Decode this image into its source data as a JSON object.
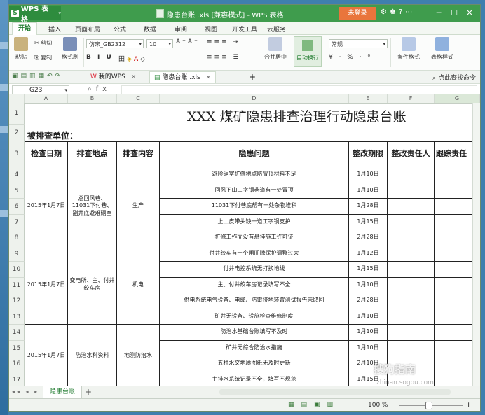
{
  "titlebar": {
    "app_name": "WPS 表格",
    "doc_title": "隐患台账 .xls [兼容模式] - WPS 表格",
    "login_label": "未登录",
    "icons": [
      "settings-icon",
      "shirt-icon",
      "help-icon",
      "more-icon"
    ]
  },
  "menu_tabs": [
    "开始",
    "插入",
    "页面布局",
    "公式",
    "数据",
    "审阅",
    "视图",
    "开发工具",
    "云服务"
  ],
  "ribbon": {
    "paste": "粘贴",
    "cut": "剪切",
    "copy": "复制",
    "format_painter": "格式刷",
    "font_name": "仿宋_GB2312",
    "font_size": "10",
    "merge": "合并居中",
    "wrap": "自动换行",
    "number_format": "常规",
    "percent_row": "¥ · % · ⁰",
    "cond_format": "条件格式",
    "table_style": "表格样式",
    "font_buttons": "B I U",
    "colors": {
      "accent": "#3f9c4d",
      "login": "#e9753c"
    }
  },
  "doc_tabs": [
    {
      "label": "我的WPS",
      "close": "×"
    },
    {
      "label": "隐患台账 .xls",
      "close": "×"
    }
  ],
  "quick_right": "点此查找命令",
  "formula_bar": {
    "name_box": "G23",
    "fx": "fx"
  },
  "columns": [
    "A",
    "B",
    "C",
    "D",
    "E",
    "F",
    "G"
  ],
  "rows": [
    "1",
    "2",
    "3",
    "4",
    "5",
    "6",
    "7",
    "8",
    "9",
    "10",
    "11",
    "12",
    "13",
    "14",
    "15",
    "16",
    "17"
  ],
  "sheet": {
    "title_prefix": "XXX",
    "title": "煤矿隐患排查治理行动隐患台账",
    "inspect_unit": "被排查单位：",
    "headers": [
      "检查日期",
      "排查地点",
      "排查内容",
      "隐患问题",
      "整改期限",
      "整改责任人",
      "跟踪责任"
    ],
    "groups": [
      {
        "date": "2015年1月7日",
        "location": "总回风巷、11031下付巷、副井底避难硐室",
        "content": "生产"
      },
      {
        "date": "2015年1月7日",
        "location": "变电所、主、付井绞车房",
        "content": "机电"
      },
      {
        "date": "2015年1月7日",
        "location": "防治水科资料",
        "content": "地测防治水"
      }
    ],
    "issues": [
      {
        "text": "避险硐室扩修地点防冒顶材料不足",
        "deadline": "1月10日"
      },
      {
        "text": "回风下山工字钢巷道有一处冒顶",
        "deadline": "1月10日"
      },
      {
        "text": "11031下付巷底帮有一处杂物堆积",
        "deadline": "1月28日"
      },
      {
        "text": "上山皮带头缺一道工字钢支护",
        "deadline": "1月15日"
      },
      {
        "text": "扩修工作面没有悬挂施工许可证",
        "deadline": "2月28日"
      },
      {
        "text": "付井绞车有一个闸间隙保护调整过大",
        "deadline": "1月12日"
      },
      {
        "text": "付井电控系统无打换地线",
        "deadline": "1月15日"
      },
      {
        "text": "主、付井绞车房记录填写不全",
        "deadline": "1月10日"
      },
      {
        "text": "供电系统电气设备、电缆、防雷接地装置测试报告未取回",
        "deadline": "2月28日"
      },
      {
        "text": "矿井无设备、设施检查维修制度",
        "deadline": "1月10日"
      },
      {
        "text": "防治水基础台账填写不及时",
        "deadline": "1月10日"
      },
      {
        "text": "矿井无综合防治水措施",
        "deadline": "1月10日"
      },
      {
        "text": "五种水文地质图纸无及时更新",
        "deadline": "2月10日"
      },
      {
        "text": "主排水系统记录不全，填写不规范",
        "deadline": "1月15日"
      }
    ]
  },
  "sheet_tab": "隐患台账",
  "status": {
    "zoom": "100 %",
    "minus": "−",
    "plus": "+"
  },
  "watermark": {
    "brand": "搜狗指南",
    "url": "zhinan.sogou.com"
  }
}
